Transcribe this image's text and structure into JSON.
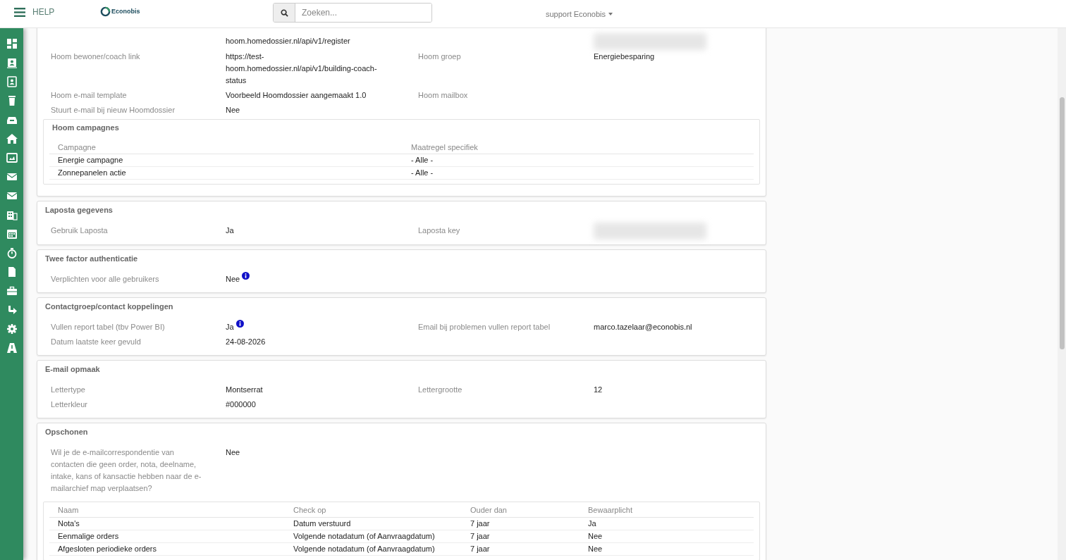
{
  "header": {
    "menu_label": "HELP",
    "logo_text": "Econobis",
    "search": {
      "placeholder": "Zoeken..."
    },
    "user": "support Econobis"
  },
  "sections": [
    {
      "rows": [
        {
          "value": "hoom.homedossier.nl/api/v1/register",
          "value2_blurred": true
        },
        {
          "label": "Hoom bewoner/coach link",
          "value": "https://test-hoom.homedossier.nl/api/v1/building-coach-status",
          "label2": "Hoom groep",
          "value2": "Energiebesparing"
        },
        {
          "label": "Hoom e-mail template",
          "value": "Voorbeeld Hoomdossier aangemaakt 1.0",
          "label2": "Hoom mailbox"
        },
        {
          "label": "Stuurt e-mail bij nieuw Hoomdossier",
          "value": "Nee"
        }
      ],
      "table": {
        "title": "Hoom campagnes",
        "columns": [
          "Campagne",
          "Maatregel specifiek"
        ],
        "rows": [
          [
            "Energie campagne",
            "- Alle -"
          ],
          [
            "Zonnepanelen actie",
            "- Alle -"
          ]
        ]
      }
    },
    {
      "title": "Laposta gegevens",
      "rows": [
        {
          "label": "Gebruik Laposta",
          "value": "Ja",
          "label2": "Laposta key",
          "value2_blurred": true
        }
      ]
    },
    {
      "title": "Twee factor authenticatie",
      "rows": [
        {
          "label": "Verplichten voor alle gebruikers",
          "value": "Nee",
          "info": true
        }
      ]
    },
    {
      "title": "Contactgroep/contact koppelingen",
      "rows": [
        {
          "label": "Vullen report tabel (tbv Power BI)",
          "value": "Ja",
          "info": true,
          "label2": "Email bij problemen vullen report tabel",
          "value2": "marco.tazelaar@econobis.nl"
        },
        {
          "label": "Datum laatste keer gevuld",
          "value": "24-08-2026"
        }
      ]
    },
    {
      "title": "E-mail opmaak",
      "rows": [
        {
          "label": "Lettertype",
          "value": "Montserrat",
          "label2": "Lettergrootte",
          "value2": "12"
        },
        {
          "label": "Letterkleur",
          "value": "#000000"
        }
      ]
    },
    {
      "title": "Opschonen",
      "rows": [
        {
          "label": "Wil je de e-mailcorrespondentie van contacten die geen order, nota, deelname, intake, kans of kansactie hebben naar de e-mailarchief map verplaatsen?",
          "value": "Nee"
        }
      ],
      "table": {
        "columns": [
          "Naam",
          "Check op",
          "Ouder dan",
          "Bewaarplicht"
        ],
        "rows": [
          [
            "Nota's",
            "Datum verstuurd",
            "7 jaar",
            "Ja"
          ],
          [
            "Eenmalige orders",
            "Volgende notadatum (of Aanvraagdatum)",
            "7 jaar",
            "Nee"
          ],
          [
            "Afgesloten periodieke orders",
            "Volgende notadatum (of Aanvraagdatum)",
            "7 jaar",
            "Nee"
          ]
        ]
      }
    }
  ]
}
